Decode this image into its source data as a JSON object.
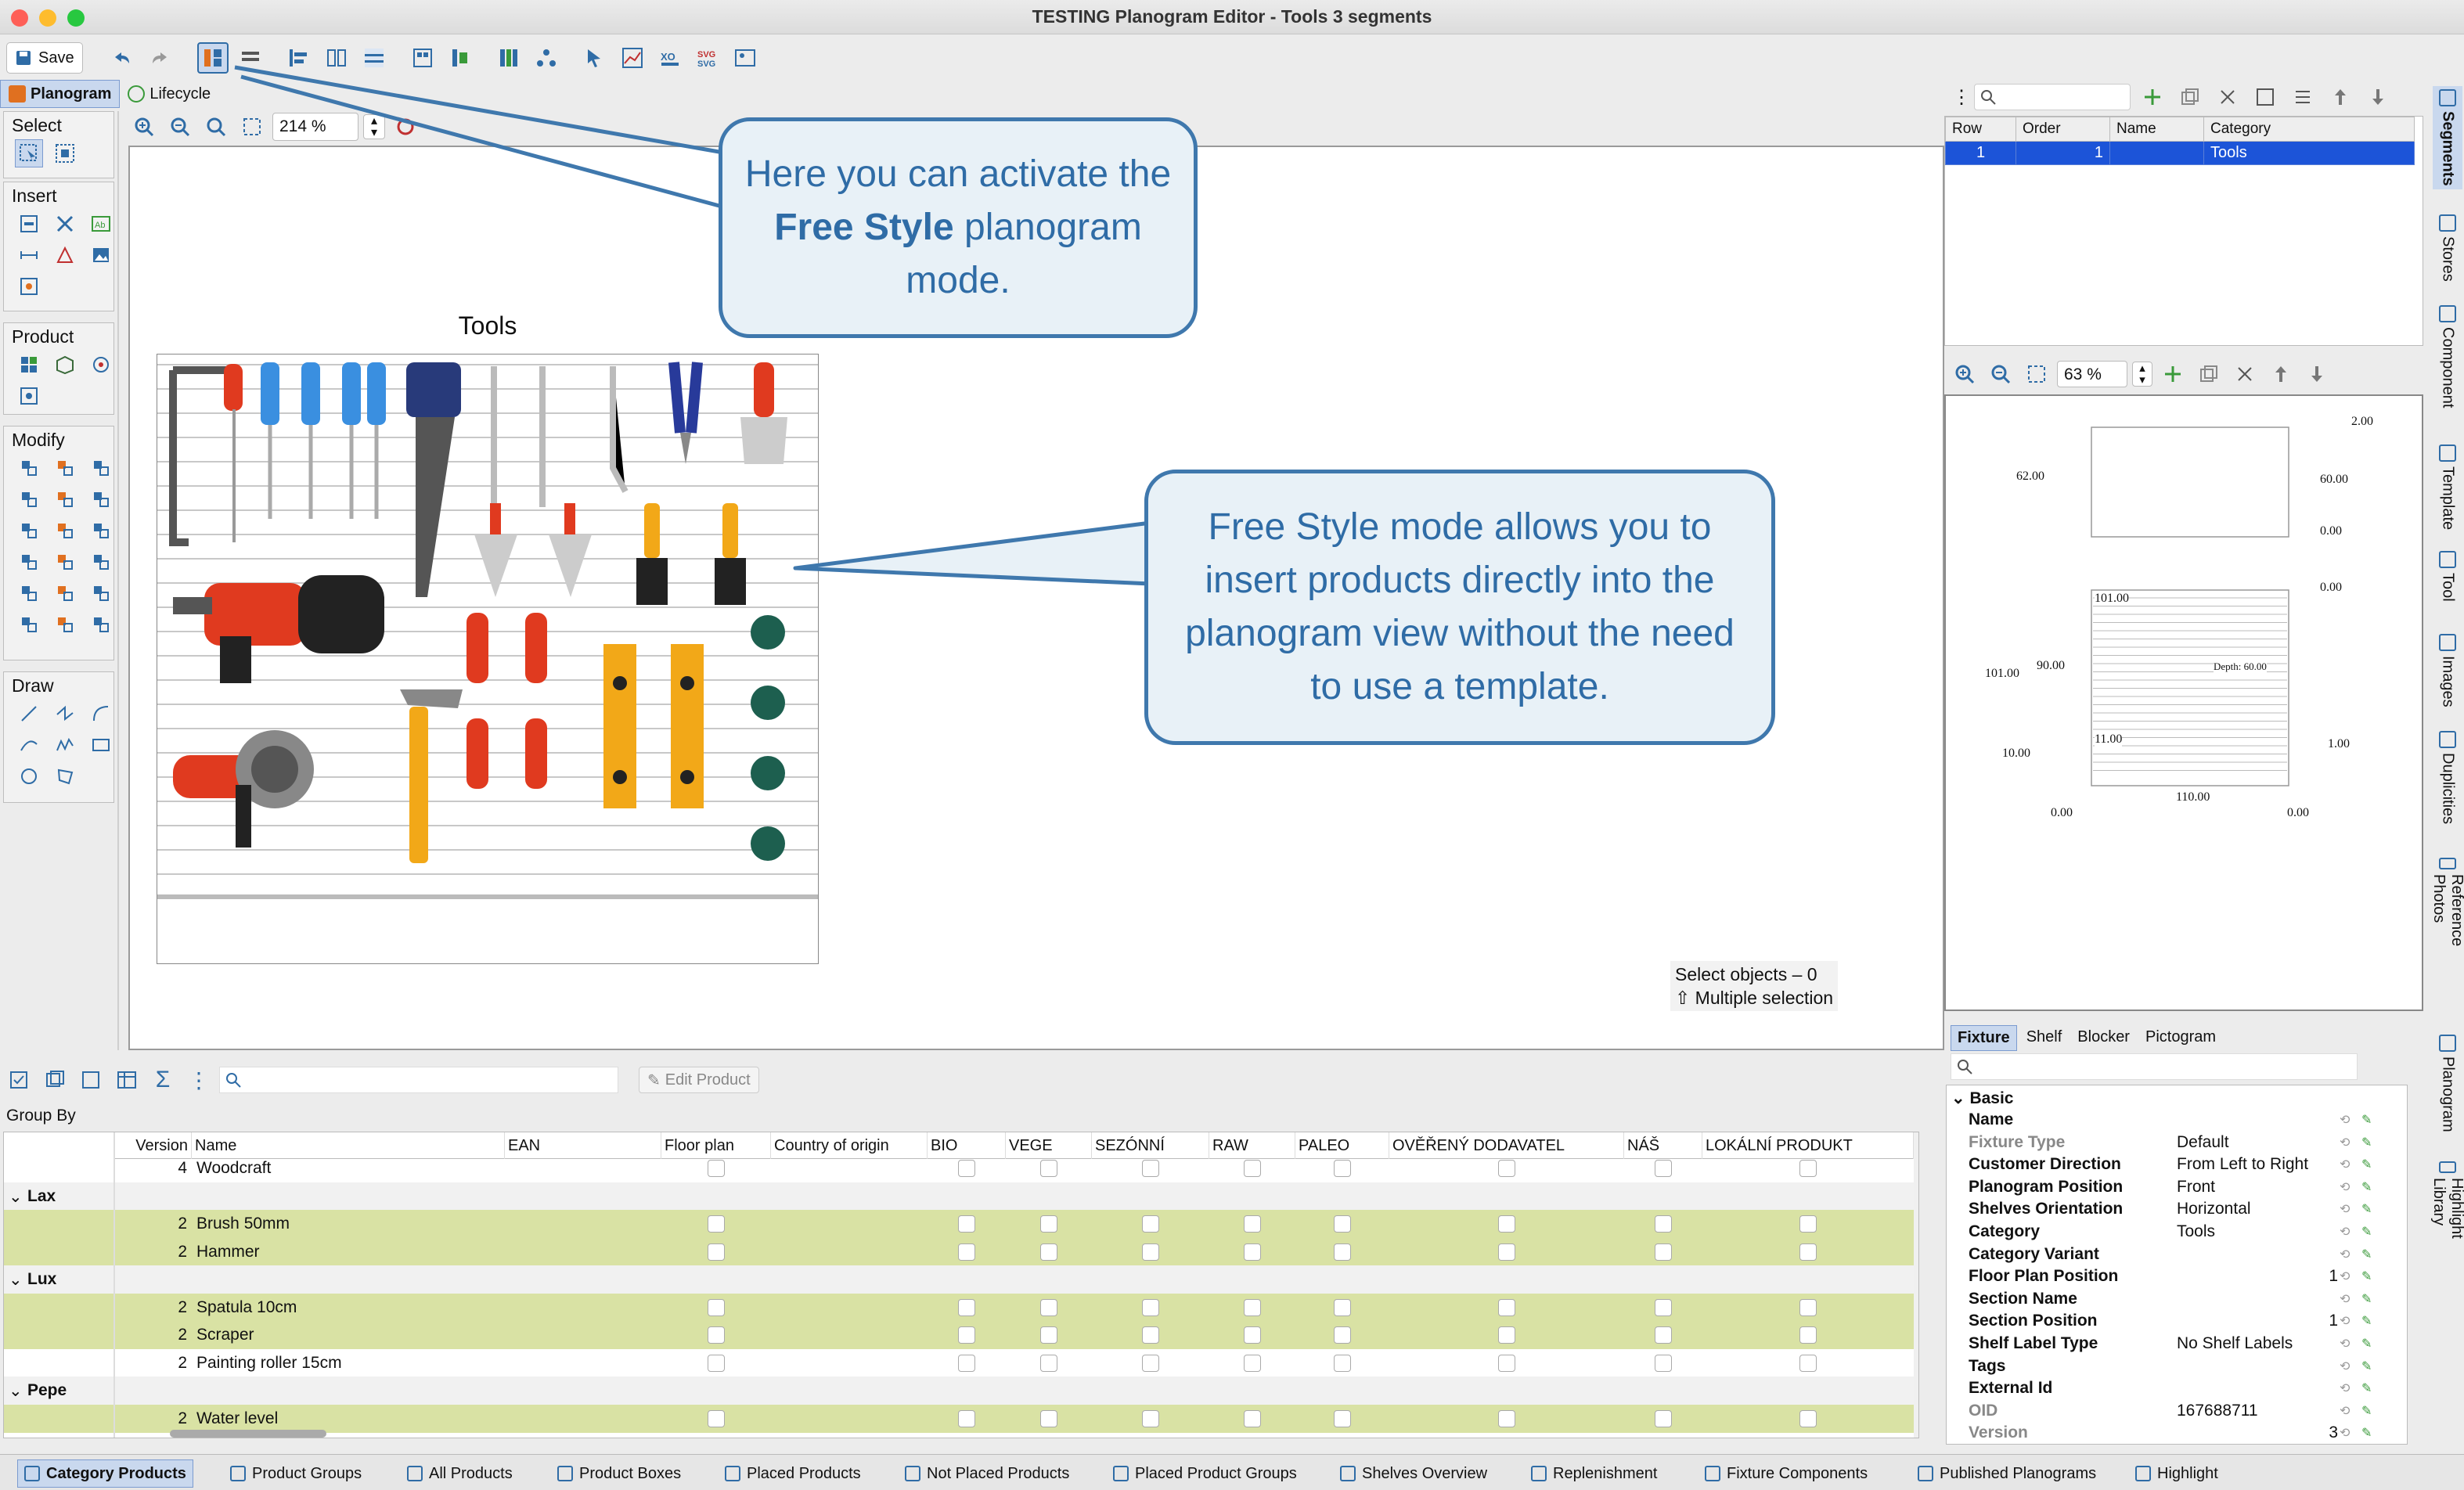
{
  "window": {
    "title": "TESTING Planogram Editor - Tools 3 segments"
  },
  "toolbar": {
    "save_label": "Save",
    "zoom": "214 %"
  },
  "main_tabs": [
    {
      "label": "Planogram"
    },
    {
      "label": "Lifecycle"
    }
  ],
  "palettes": {
    "select": "Select",
    "insert": "Insert",
    "product": "Product",
    "modify": "Modify",
    "draw": "Draw"
  },
  "canvas": {
    "segment_title": "Tools",
    "status_line1": "Select objects – 0",
    "status_line2": "⇧ Multiple selection"
  },
  "callouts": {
    "top": {
      "pre": "Here you can activate the ",
      "bold": "Free Style",
      "post": " planogram mode."
    },
    "middle": "Free Style mode allows you to insert products directly into the planogram view without the need to use a template."
  },
  "segments_panel": {
    "headers": [
      "Row",
      "Order",
      "Name",
      "Category"
    ],
    "row": {
      "row": "1",
      "order": "1",
      "name": "",
      "category": "Tools"
    }
  },
  "fixture_preview": {
    "zoom": "63 %",
    "dims": {
      "top_right": "2.00",
      "left_top": "62.00",
      "right_top": "60.00",
      "r1": "0.00",
      "r2": "0.00",
      "inner_top": "101.00",
      "left_mid": "101.00",
      "inner_mid": "90.00",
      "depth": "Depth: 60.00",
      "inner_low": "11.00",
      "left_low": "10.00",
      "right_low": "1.00",
      "bottom_center": "110.00",
      "bottom_left": "0.00",
      "bottom_right": "0.00"
    }
  },
  "props_tabs": [
    {
      "label": "Fixture"
    },
    {
      "label": "Shelf"
    },
    {
      "label": "Blocker"
    },
    {
      "label": "Pictogram"
    }
  ],
  "properties": {
    "section": "Basic",
    "rows": [
      {
        "key": "Name",
        "value": "",
        "num": ""
      },
      {
        "key": "Fixture Type",
        "value": "Default",
        "num": ""
      },
      {
        "key": "Customer Direction",
        "value": "From Left to Right",
        "num": ""
      },
      {
        "key": "Planogram Position",
        "value": "Front",
        "num": ""
      },
      {
        "key": "Shelves Orientation",
        "value": "Horizontal",
        "num": ""
      },
      {
        "key": "Category",
        "value": "Tools",
        "num": ""
      },
      {
        "key": "Category Variant",
        "value": "",
        "num": ""
      },
      {
        "key": "Floor Plan Position",
        "value": "",
        "num": "1"
      },
      {
        "key": "Section Name",
        "value": "",
        "num": ""
      },
      {
        "key": "Section Position",
        "value": "",
        "num": "1"
      },
      {
        "key": "Shelf Label Type",
        "value": "No Shelf Labels",
        "num": ""
      },
      {
        "key": "Tags",
        "value": "",
        "num": ""
      },
      {
        "key": "External Id",
        "value": "",
        "num": ""
      },
      {
        "key": "OID",
        "value": "167688711",
        "num": ""
      },
      {
        "key": "Version",
        "value": "",
        "num": "3"
      }
    ]
  },
  "products_toolbar": {
    "edit_label": "Edit Product"
  },
  "products_table": {
    "group_by": "Group By",
    "columns": [
      "Version",
      "Name",
      "EAN",
      "Floor plan",
      "Country of origin",
      "BIO",
      "VEGE",
      "SEZÓNNÍ",
      "RAW",
      "PALEO",
      "OVĚŘENÝ DODAVATEL",
      "NÁŠ",
      "LOKÁLNÍ PRODUKT"
    ],
    "rows": [
      {
        "type": "item",
        "version": "4",
        "name": "Woodcraft",
        "green": false
      },
      {
        "type": "group",
        "name": "Lax"
      },
      {
        "type": "item",
        "version": "2",
        "name": "Brush 50mm",
        "green": true
      },
      {
        "type": "item",
        "version": "2",
        "name": "Hammer",
        "green": true
      },
      {
        "type": "group",
        "name": "Lux"
      },
      {
        "type": "item",
        "version": "2",
        "name": "Spatula 10cm",
        "green": true
      },
      {
        "type": "item",
        "version": "2",
        "name": "Scraper",
        "green": true
      },
      {
        "type": "item",
        "version": "2",
        "name": "Painting roller 15cm",
        "green": false
      },
      {
        "type": "group",
        "name": "Pepe"
      },
      {
        "type": "item",
        "version": "2",
        "name": "Water level",
        "green": true
      }
    ]
  },
  "bottom_tabs": [
    "Category Products",
    "Product Groups",
    "All Products",
    "Product Boxes",
    "Placed Products",
    "Not Placed Products",
    "Placed Product Groups",
    "Shelves Overview",
    "Replenishment",
    "Fixture Components",
    "Published Planograms",
    "Highlight"
  ],
  "side_tabs": [
    "Segments",
    "Stores",
    "Component",
    "Template",
    "Tool",
    "Images",
    "Duplicities",
    "Reference Photos",
    "Planogram",
    "Highlight Library"
  ]
}
